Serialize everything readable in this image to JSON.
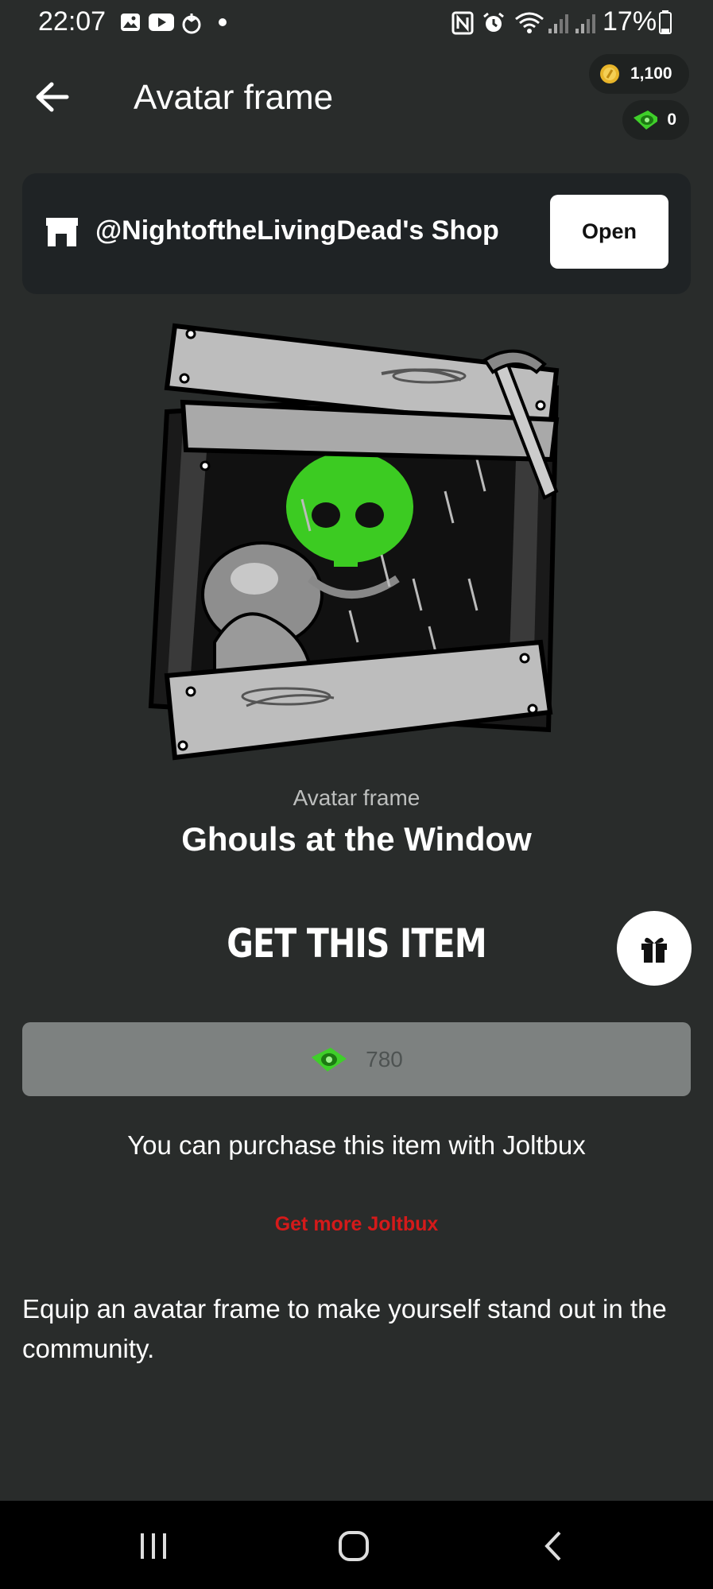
{
  "status_bar": {
    "time": "22:07",
    "battery": "17%"
  },
  "header": {
    "title": "Avatar frame",
    "coin_balance": "1,100",
    "joltbux_balance": "0"
  },
  "shop": {
    "name": "@NightoftheLivingDead's Shop",
    "open_label": "Open"
  },
  "item": {
    "type": "Avatar frame",
    "name": "Ghouls at the Window"
  },
  "purchase": {
    "heading": "GET THIS ITEM",
    "price": "780",
    "note": "You can purchase this item with Joltbux",
    "get_more_label": "Get more Joltbux"
  },
  "description": "Equip an avatar frame to make yourself stand out in the community.",
  "colors": {
    "background": "#292c2b",
    "card": "#1f2325",
    "buy_button": "#7d8180",
    "link_red": "#d41a1a",
    "joltbux_green": "#3fcf2a",
    "coin_gold": "#e8b52a"
  }
}
